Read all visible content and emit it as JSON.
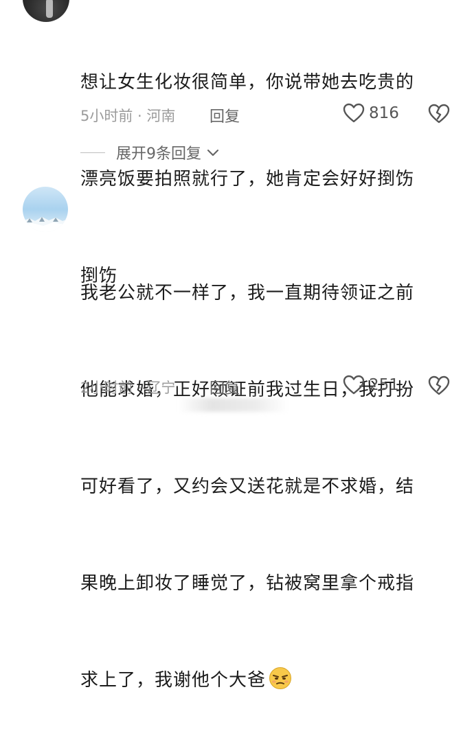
{
  "comments": [
    {
      "lines": [
        "想让女生化妆很简单，你说带她去吃贵的",
        "漂亮饭要拍照就行了，她肯定会好好捯饬",
        "捯饬"
      ],
      "meta": "5小时前 · 河南",
      "reply_label": "回复",
      "likes": "816"
    },
    {
      "lines": [
        "我老公就不一样了，我一直期待领证之前",
        "他能求婚，正好领证前我过生日，我打扮",
        "可好看了，又约会又送花就是不求婚，结",
        "果晚上卸妆了睡觉了，钻被窝里拿个戒指",
        "求上了，我谢他个大爸"
      ],
      "emoji": "annoyed-face-emoji",
      "meta": "2小时前 · 辽宁",
      "reply_label": "回复",
      "likes": "251"
    }
  ],
  "expand_replies_label": "展开9条回复",
  "icons": {
    "like": "heart-outline-icon",
    "dislike": "broken-heart-icon",
    "expand": "chevron-down-icon"
  },
  "colors": {
    "text": "#1c1c1c",
    "meta": "#9b9b9b",
    "icon": "#555555"
  }
}
